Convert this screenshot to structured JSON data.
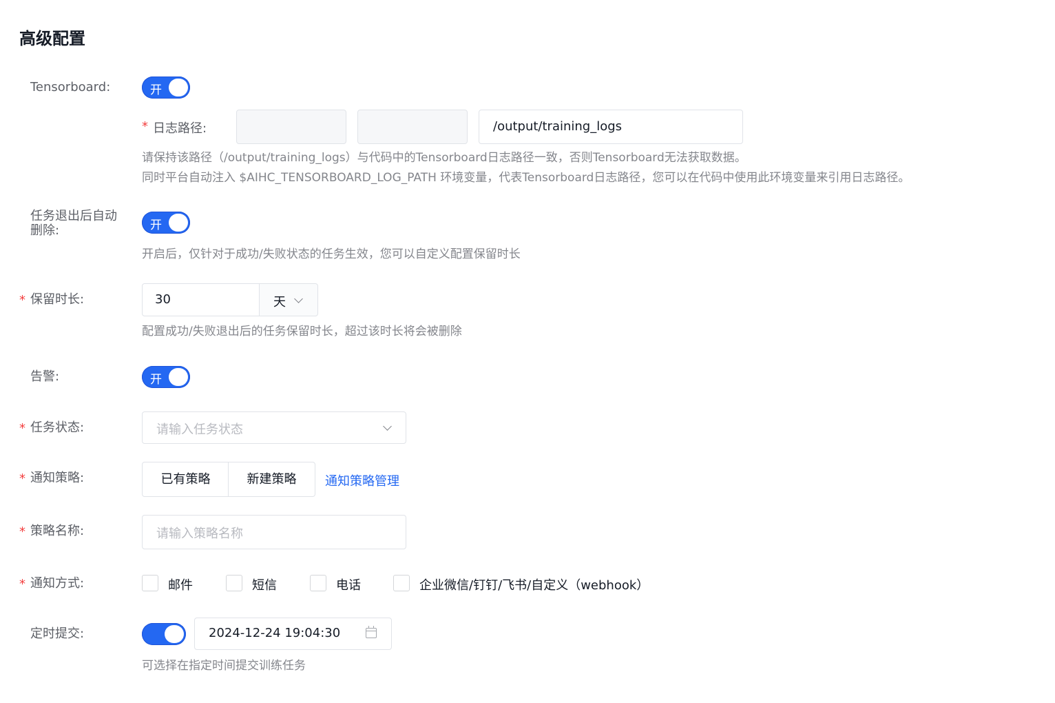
{
  "page_title": "高级配置",
  "tensorboard": {
    "label": "Tensorboard:",
    "switch_text": "开",
    "log_path_label": "日志路径:",
    "log_path_value": "/output/training_logs",
    "help_line1": "请保持该路径（/output/training_logs）与代码中的Tensorboard日志路径一致，否则Tensorboard无法获取数据。",
    "help_line2": "同时平台自动注入 $AIHC_TENSORBOARD_LOG_PATH 环境变量，代表Tensorboard日志路径，您可以在代码中使用此环境变量来引用日志路径。"
  },
  "auto_delete": {
    "label": "任务退出后自动删除:",
    "switch_text": "开",
    "help": "开启后，仅针对于成功/失败状态的任务生效，您可以自定义配置保留时长"
  },
  "retention": {
    "label": "保留时长:",
    "value": "30",
    "unit": "天",
    "help": "配置成功/失败退出后的任务保留时长，超过该时长将会被删除"
  },
  "alarm": {
    "label": "告警:",
    "switch_text": "开"
  },
  "task_status": {
    "label": "任务状态:",
    "placeholder": "请输入任务状态"
  },
  "notify_policy": {
    "label": "通知策略:",
    "option_existing": "已有策略",
    "option_new": "新建策略",
    "manage_link": "通知策略管理"
  },
  "policy_name": {
    "label": "策略名称:",
    "placeholder": "请输入策略名称"
  },
  "notify_method": {
    "label": "通知方式:",
    "options": [
      "邮件",
      "短信",
      "电话",
      "企业微信/钉钉/飞书/自定义（webhook）"
    ]
  },
  "scheduled_submit": {
    "label": "定时提交:",
    "datetime": "2024-12-24 19:04:30",
    "help": "可选择在指定时间提交训练任务"
  },
  "colors": {
    "primary": "#2468f2",
    "required": "#f33e3e",
    "help_text": "#84868c"
  }
}
